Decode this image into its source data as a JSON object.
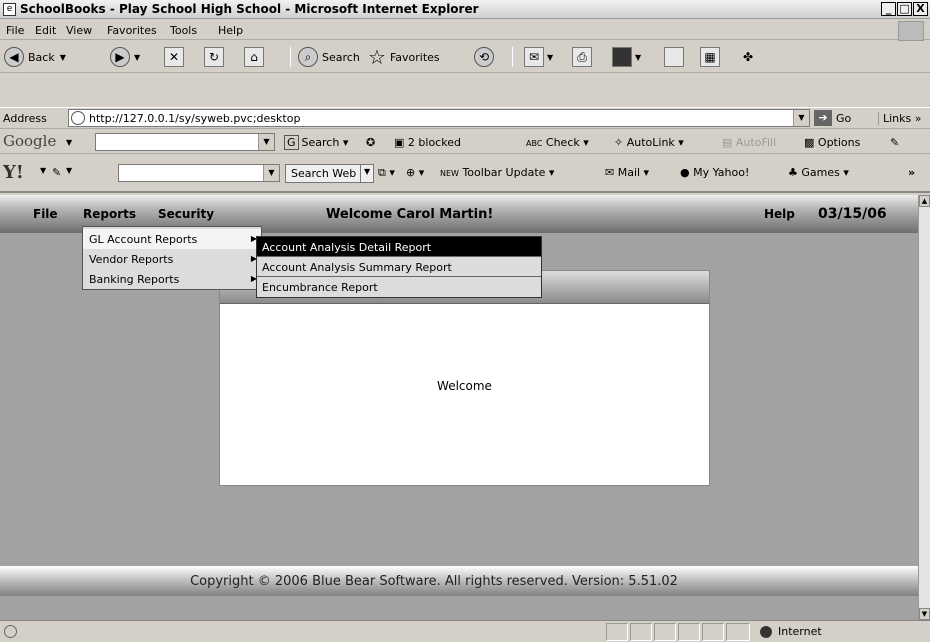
{
  "window": {
    "title": "SchoolBooks - Play School High School - Microsoft Internet Explorer",
    "minimize": "_",
    "maximize": "□",
    "close": "X"
  },
  "ie_menu": [
    "File",
    "Edit",
    "View",
    "Favorites",
    "Tools",
    "Help"
  ],
  "toolbar": {
    "back": "Back",
    "search": "Search",
    "favorites": "Favorites"
  },
  "address": {
    "label": "Address",
    "url": "http://127.0.0.1/sy/syweb.pvc;desktop",
    "go": "Go",
    "links": "Links »"
  },
  "google_bar": {
    "logo": "Google",
    "search": "Search",
    "blocked": "2 blocked",
    "check": "Check",
    "autolink": "AutoLink",
    "autofill": "AutoFill",
    "options": "Options"
  },
  "yahoo_bar": {
    "logo": "Y!",
    "search_web": "Search Web",
    "toolbar_update": "Toolbar Update",
    "new_badge": "NEW",
    "mail": "Mail",
    "my_yahoo": "My Yahoo!",
    "games": "Games",
    "more": "»"
  },
  "app": {
    "menu": {
      "file": "File",
      "reports": "Reports",
      "security": "Security"
    },
    "welcome": "Welcome Carol Martin!",
    "help": "Help",
    "date": "03/15/06",
    "panel_text": "Welcome",
    "footer": "Copyright © 2006 Blue Bear Software. All rights reserved. Version: 5.51.02",
    "reports_menu": [
      "GL Account Reports",
      "Vendor Reports",
      "Banking Reports"
    ],
    "gl_submenu": [
      "Account Analysis Detail Report",
      "Account Analysis Summary Report",
      "Encumbrance Report"
    ]
  },
  "status": {
    "zone": "Internet"
  }
}
